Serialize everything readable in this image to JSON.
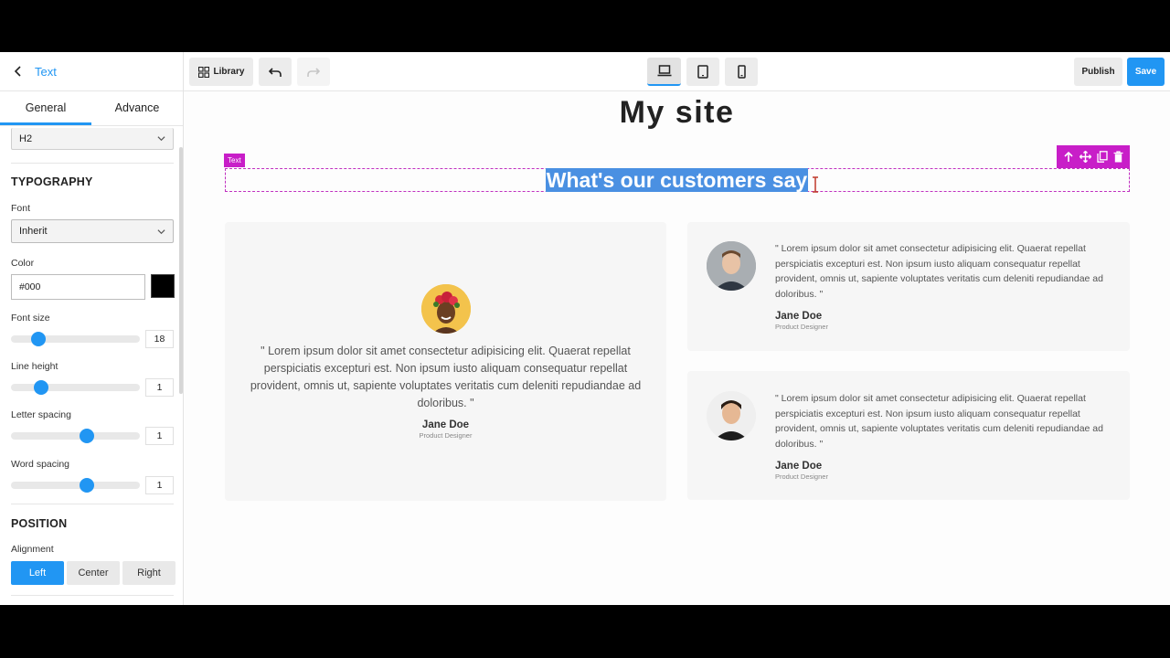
{
  "sidebar": {
    "title": "Text",
    "tabs": [
      "General",
      "Advance"
    ],
    "heading_tag": "H2",
    "typography": {
      "title": "TYPOGRAPHY",
      "font_label": "Font",
      "font_value": "Inherit",
      "color_label": "Color",
      "color_value": "#000",
      "font_size_label": "Font size",
      "font_size_value": "18",
      "line_height_label": "Line height",
      "line_height_value": "1",
      "letter_spacing_label": "Letter spacing",
      "letter_spacing_value": "1",
      "word_spacing_label": "Word spacing",
      "word_spacing_value": "1"
    },
    "position": {
      "title": "POSITION",
      "alignment_label": "Alignment",
      "options": [
        "Left",
        "Center",
        "Right"
      ],
      "selected": "Left"
    }
  },
  "toolbar": {
    "library_label": "Library",
    "publish_label": "Publish",
    "save_label": "Save"
  },
  "canvas": {
    "site_title": "My site",
    "selected_tag": "Text",
    "heading": "What's our customers say",
    "testimonials": [
      {
        "quote": "\" Lorem ipsum dolor sit amet consectetur adipisicing elit. Quaerat repellat perspiciatis excepturi est. Non ipsum iusto aliquam consequatur repellat provident, omnis ut, sapiente voluptates veritatis cum deleniti repudiandae ad doloribus. \"",
        "name": "Jane Doe",
        "role": "Product Designer"
      },
      {
        "quote": "\" Lorem ipsum dolor sit amet consectetur adipisicing elit. Quaerat repellat perspiciatis excepturi est. Non ipsum iusto aliquam consequatur repellat provident, omnis ut, sapiente voluptates veritatis cum deleniti repudiandae ad doloribus. \"",
        "name": "Jane Doe",
        "role": "Product Designer"
      },
      {
        "quote": "\" Lorem ipsum dolor sit amet consectetur adipisicing elit. Quaerat repellat perspiciatis excepturi est. Non ipsum iusto aliquam consequatur repellat provident, omnis ut, sapiente voluptates veritatis cum deleniti repudiandae ad doloribus. \"",
        "name": "Jane Doe",
        "role": "Product Designer"
      }
    ]
  },
  "colors": {
    "accent": "#2196f3",
    "selection": "#c81ec8",
    "text_highlight": "#4a90e2"
  }
}
